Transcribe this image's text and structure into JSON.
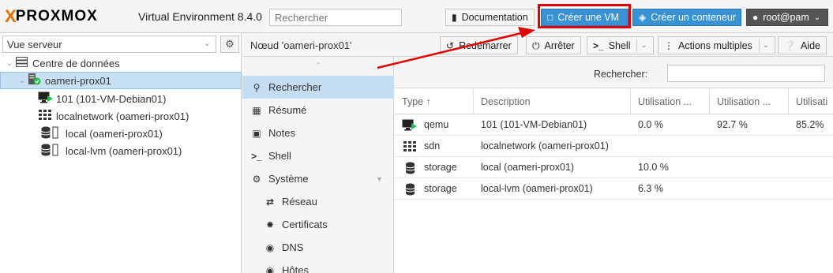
{
  "topbar": {
    "logo_x": "X",
    "logo_word": "PROXMOX",
    "version": "Virtual Environment 8.4.0",
    "search_placeholder": "Rechercher",
    "doc_label": "Documentation",
    "create_vm_label": "Créer une VM",
    "create_ct_label": "Créer un conteneur",
    "user_label": "root@pam"
  },
  "tree": {
    "view": "Vue serveur",
    "items": [
      {
        "label": "Centre de données",
        "icon": "server-stack-icon"
      },
      {
        "label": "oameri-prox01",
        "icon": "node-icon"
      },
      {
        "label": "101 (101-VM-Debian01)",
        "icon": "vm-running-icon"
      },
      {
        "label": "localnetwork (oameri-prox01)",
        "icon": "sdn-grid-icon"
      },
      {
        "label": "local (oameri-prox01)",
        "icon": "storage-icon"
      },
      {
        "label": "local-lvm (oameri-prox01)",
        "icon": "storage-icon"
      }
    ]
  },
  "node_header": {
    "title": "Nœud 'oameri-prox01'",
    "restart": "Redémarrer",
    "shutdown": "Arrêter",
    "shell": "Shell",
    "bulk": "Actions multiples",
    "help": "Aide"
  },
  "menu": {
    "items": [
      {
        "label": "Rechercher",
        "icon": "search-icon"
      },
      {
        "label": "Résumé",
        "icon": "summary-icon"
      },
      {
        "label": "Notes",
        "icon": "notes-icon"
      },
      {
        "label": "Shell",
        "icon": "terminal-icon"
      },
      {
        "label": "Système",
        "icon": "cogs-icon"
      },
      {
        "label": "Réseau",
        "icon": "exchange-icon"
      },
      {
        "label": "Certificats",
        "icon": "certificate-icon"
      },
      {
        "label": "DNS",
        "icon": "globe-icon"
      },
      {
        "label": "Hôtes",
        "icon": "globe-icon"
      }
    ]
  },
  "grid": {
    "search_label": "Rechercher:",
    "columns": [
      "Type ↑",
      "Description",
      "Utilisation ...",
      "Utilisation ...",
      "Utilisati"
    ],
    "rows": [
      {
        "type": "qemu",
        "desc": "101 (101-VM-Debian01)",
        "u1": "0.0 %",
        "u2": "92.7 %",
        "u3": "85.2%",
        "icon": "vm-running-icon"
      },
      {
        "type": "sdn",
        "desc": "localnetwork (oameri-prox01)",
        "u1": "",
        "u2": "",
        "u3": "",
        "icon": "sdn-grid-icon"
      },
      {
        "type": "storage",
        "desc": "local (oameri-prox01)",
        "u1": "10.0 %",
        "u2": "",
        "u3": "",
        "icon": "storage-icon"
      },
      {
        "type": "storage",
        "desc": "local-lvm (oameri-prox01)",
        "u1": "6.3 %",
        "u2": "",
        "u3": "",
        "icon": "storage-icon"
      }
    ]
  },
  "colors": {
    "accent": "#3892d4",
    "brand_orange": "#e57000",
    "highlight": "#e00000"
  }
}
